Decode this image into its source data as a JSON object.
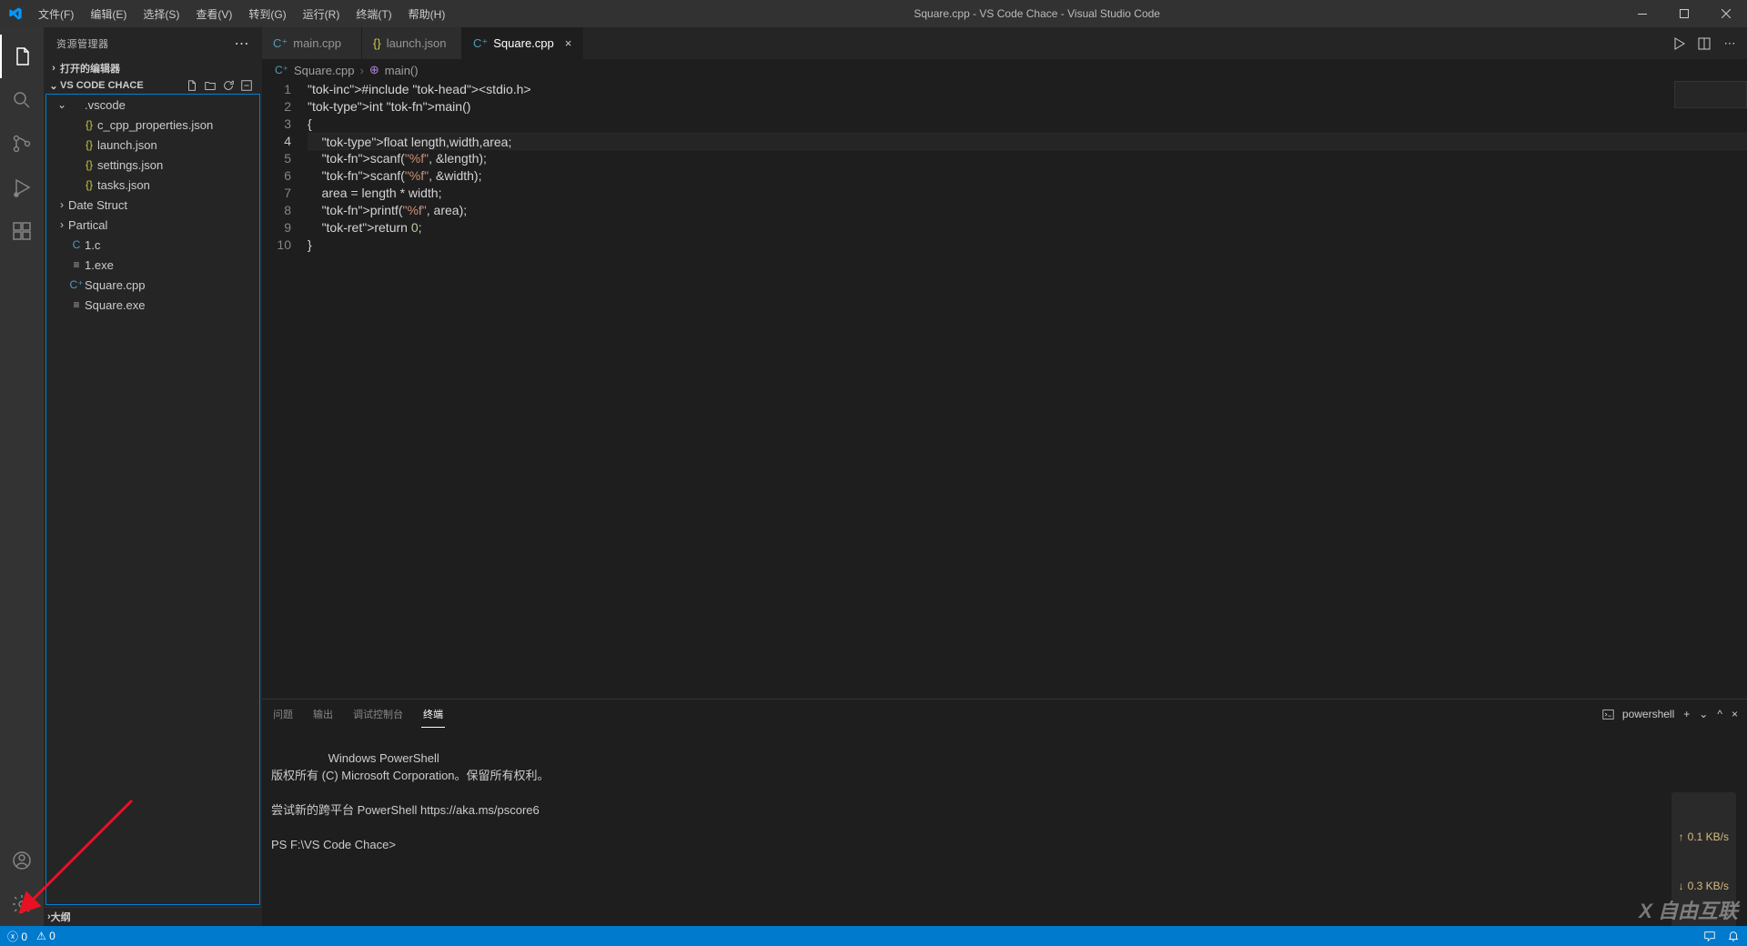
{
  "window": {
    "title": "Square.cpp - VS Code Chace - Visual Studio Code"
  },
  "menu": {
    "file": "文件(F)",
    "edit": "编辑(E)",
    "select": "选择(S)",
    "view": "查看(V)",
    "goto": "转到(G)",
    "run": "运行(R)",
    "terminal": "终端(T)",
    "help": "帮助(H)"
  },
  "sidebar": {
    "title": "资源管理器",
    "open_editors": "打开的编辑器",
    "workspace": "VS CODE CHACE",
    "outline": "大纲",
    "tree": {
      "vscode": ".vscode",
      "files": [
        {
          "name": "c_cpp_properties.json",
          "kind": "json"
        },
        {
          "name": "launch.json",
          "kind": "json"
        },
        {
          "name": "settings.json",
          "kind": "json"
        },
        {
          "name": "tasks.json",
          "kind": "json"
        }
      ],
      "folders": [
        "Date Struct",
        "Partical"
      ],
      "root_files": [
        {
          "name": "1.c",
          "kind": "c"
        },
        {
          "name": "1.exe",
          "kind": "exe"
        },
        {
          "name": "Square.cpp",
          "kind": "cpp"
        },
        {
          "name": "Square.exe",
          "kind": "exe"
        }
      ]
    }
  },
  "tabs": [
    {
      "label": "main.cpp",
      "icon": "cpp",
      "active": false
    },
    {
      "label": "launch.json",
      "icon": "json",
      "active": false
    },
    {
      "label": "Square.cpp",
      "icon": "cpp",
      "active": true
    }
  ],
  "breadcrumb": {
    "file": "Square.cpp",
    "symbol": "main()"
  },
  "code": {
    "lines": [
      "#include <stdio.h>",
      "int main()",
      "{",
      "    float length,width,area;",
      "    scanf(\"%f\", &length);",
      "    scanf(\"%f\", &width);",
      "    area = length * width;",
      "    printf(\"%f\", area);",
      "    return 0;",
      "}"
    ],
    "current_line": 4
  },
  "panel": {
    "tabs": {
      "problems": "问题",
      "output": "输出",
      "debug": "调试控制台",
      "terminal": "终端"
    },
    "shell_label": "powershell",
    "terminal_text": "Windows PowerShell\n版权所有 (C) Microsoft Corporation。保留所有权利。\n\n尝试新的跨平台 PowerShell https://aka.ms/pscore6\n\nPS F:\\VS Code Chace>"
  },
  "speed": {
    "up": "0.1 KB/s",
    "down": "0.3 KB/s"
  },
  "statusbar": {
    "errors": "0",
    "warnings": "0"
  },
  "watermark": "自由互联"
}
